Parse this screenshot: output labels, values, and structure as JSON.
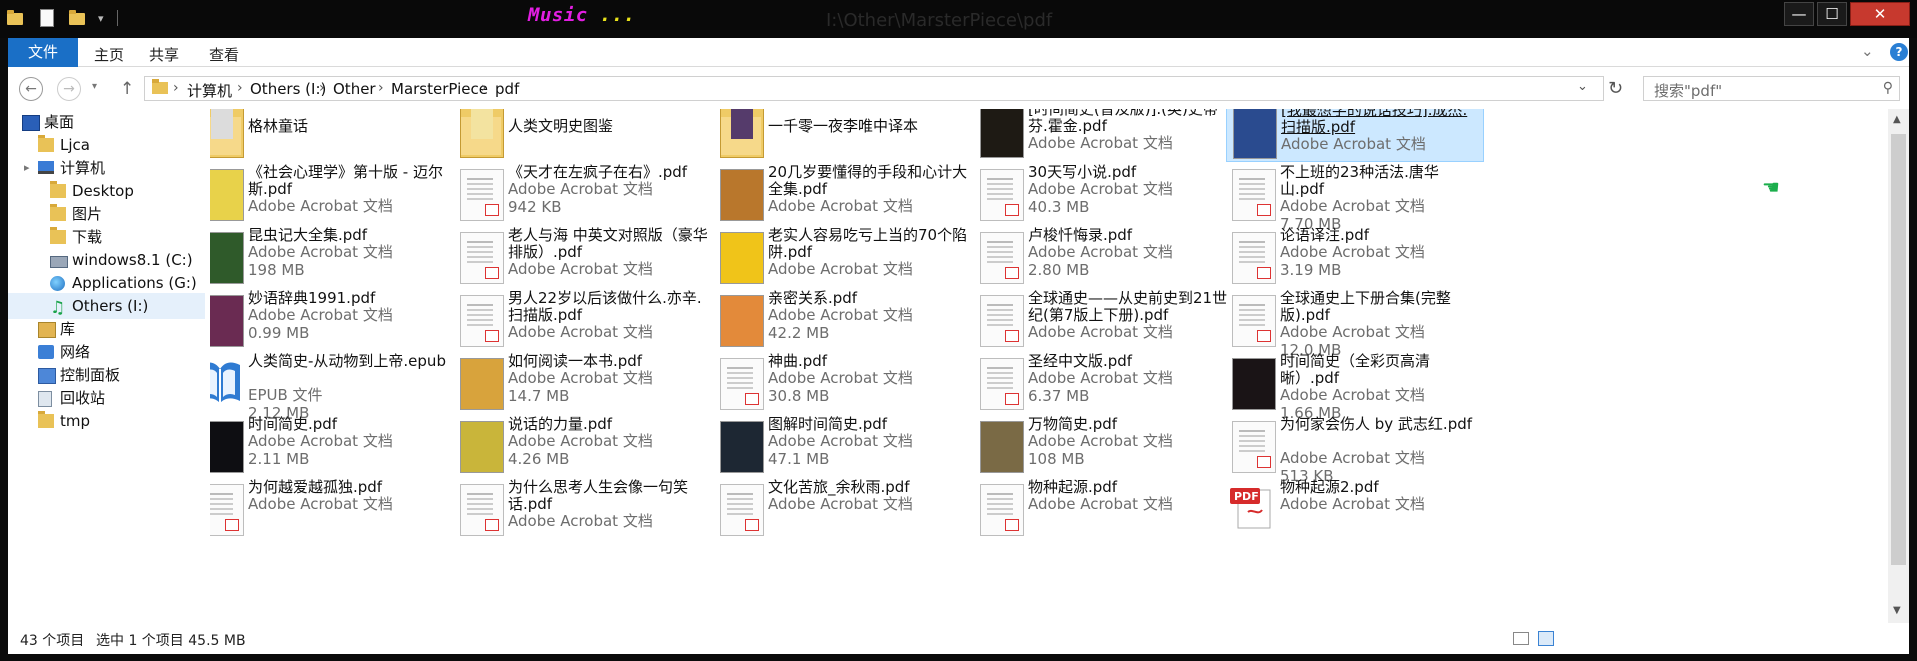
{
  "titlebar": {
    "app_title": "Music",
    "app_dots": " ...",
    "path_title": "I:\\Other\\MarsterPiece\\pdf",
    "quick_access_arrow": "▾",
    "minimize": "—",
    "maximize": "☐",
    "close": "✕"
  },
  "ribbon": {
    "file": "文件",
    "tabs": [
      "主页",
      "共享",
      "查看"
    ]
  },
  "address": {
    "crumbs": [
      "计算机",
      "Others (I:)",
      "Other",
      "MarsterPiece",
      "pdf"
    ],
    "search_placeholder": "搜索\"pdf\""
  },
  "nav": [
    {
      "label": "桌面",
      "icon": "desktop-icon"
    },
    {
      "label": "Ljca",
      "icon": "folder-icon"
    },
    {
      "label": "计算机",
      "icon": "computer-icon"
    },
    {
      "label": "Desktop",
      "icon": "folder-icon"
    },
    {
      "label": "图片",
      "icon": "folder-icon"
    },
    {
      "label": "下载",
      "icon": "folder-icon"
    },
    {
      "label": "windows8.1 (C:)",
      "icon": "drive-icon"
    },
    {
      "label": "Applications (G:)",
      "icon": "globe-drive-icon"
    },
    {
      "label": "Others (I:)",
      "icon": "music-drive-icon",
      "selected": true
    },
    {
      "label": "库",
      "icon": "library-icon"
    },
    {
      "label": "网络",
      "icon": "network-icon"
    },
    {
      "label": "控制面板",
      "icon": "control-panel-icon"
    },
    {
      "label": "回收站",
      "icon": "recycle-bin-icon"
    },
    {
      "label": "tmp",
      "icon": "folder-icon"
    }
  ],
  "files": [
    {
      "name": "格林童话",
      "type": "",
      "size": "",
      "thumb": "folder",
      "cover": "#dcdcdc"
    },
    {
      "name": "人类文明史图鉴",
      "type": "",
      "size": "",
      "thumb": "folder",
      "cover": "#f3e3a0"
    },
    {
      "name": "一千零一夜李唯中译本",
      "type": "",
      "size": "",
      "thumb": "folder",
      "cover": "#553b6b"
    },
    {
      "name": "[时间简史(普及版)].(英)史蒂芬.霍金.pdf",
      "type": "Adobe Acrobat 文档",
      "size": "",
      "thumb": "cover",
      "cover": "#1e1a14"
    },
    {
      "name": "[我最想学的说话技巧].成杰.扫描版.pdf",
      "type": "Adobe Acrobat 文档",
      "size": "",
      "thumb": "cover",
      "cover": "#2a4b8f",
      "selected": true
    },
    {
      "name": "《社会心理学》第十版 - 迈尔斯.pdf",
      "type": "Adobe Acrobat 文档",
      "size": "",
      "thumb": "cover",
      "cover": "#e8d24a"
    },
    {
      "name": "《天才在左疯子在右》.pdf",
      "type": "Adobe Acrobat 文档",
      "size": "942 KB",
      "thumb": "page",
      "cover": "#ffffff"
    },
    {
      "name": "20几岁要懂得的手段和心计大全集.pdf",
      "type": "Adobe Acrobat 文档",
      "size": "",
      "thumb": "cover",
      "cover": "#b9772c"
    },
    {
      "name": "30天写小说.pdf",
      "type": "Adobe Acrobat 文档",
      "size": "40.3 MB",
      "thumb": "page",
      "cover": "#ffffff"
    },
    {
      "name": "不上班的23种活法.唐华山.pdf",
      "type": "Adobe Acrobat 文档",
      "size": "7.70 MB",
      "thumb": "page",
      "cover": "#ffffff"
    },
    {
      "name": "昆虫记大全集.pdf",
      "type": "Adobe Acrobat 文档",
      "size": "198 MB",
      "thumb": "cover",
      "cover": "#2f5a2a"
    },
    {
      "name": "老人与海 中英文对照版（豪华排版）.pdf",
      "type": "Adobe Acrobat 文档",
      "size": "",
      "thumb": "page",
      "cover": "#ffffff"
    },
    {
      "name": "老实人容易吃亏上当的70个陷阱.pdf",
      "type": "Adobe Acrobat 文档",
      "size": "",
      "thumb": "cover",
      "cover": "#f0c419"
    },
    {
      "name": "卢梭忏悔录.pdf",
      "type": "Adobe Acrobat 文档",
      "size": "2.80 MB",
      "thumb": "page",
      "cover": "#ffffff"
    },
    {
      "name": "论语译注.pdf",
      "type": "Adobe Acrobat 文档",
      "size": "3.19 MB",
      "thumb": "page",
      "cover": "#ffffff"
    },
    {
      "name": "妙语辞典1991.pdf",
      "type": "Adobe Acrobat 文档",
      "size": "0.99 MB",
      "thumb": "cover",
      "cover": "#6a2b52"
    },
    {
      "name": "男人22岁以后该做什么.亦辛.扫描版.pdf",
      "type": "Adobe Acrobat 文档",
      "size": "",
      "thumb": "page",
      "cover": "#ffffff"
    },
    {
      "name": "亲密关系.pdf",
      "type": "Adobe Acrobat 文档",
      "size": "42.2 MB",
      "thumb": "cover",
      "cover": "#e38a3a"
    },
    {
      "name": "全球通史——从史前史到21世纪(第7版上下册).pdf",
      "type": "Adobe Acrobat 文档",
      "size": "",
      "thumb": "page",
      "cover": "#ffffff"
    },
    {
      "name": "全球通史上下册合集(完整版).pdf",
      "type": "Adobe Acrobat 文档",
      "size": "12.0 MB",
      "thumb": "page",
      "cover": "#ffffff"
    },
    {
      "name": "人类简史-从动物到上帝.epub",
      "type": "EPUB 文件",
      "size": "2.12 MB",
      "thumb": "epub",
      "cover": "#2f7bd2"
    },
    {
      "name": "如何阅读一本书.pdf",
      "type": "Adobe Acrobat 文档",
      "size": "14.7 MB",
      "thumb": "cover",
      "cover": "#d8a33c"
    },
    {
      "name": "神曲.pdf",
      "type": "Adobe Acrobat 文档",
      "size": "30.8 MB",
      "thumb": "page",
      "cover": "#ffffff"
    },
    {
      "name": "圣经中文版.pdf",
      "type": "Adobe Acrobat 文档",
      "size": "6.37 MB",
      "thumb": "page",
      "cover": "#ffffff"
    },
    {
      "name": "时间简史（全彩页高清晰）.pdf",
      "type": "Adobe Acrobat 文档",
      "size": "1.66 MB",
      "thumb": "cover",
      "cover": "#1a1416"
    },
    {
      "name": "时间简史.pdf",
      "type": "Adobe Acrobat 文档",
      "size": "2.11 MB",
      "thumb": "cover",
      "cover": "#0e0e12"
    },
    {
      "name": "说话的力量.pdf",
      "type": "Adobe Acrobat 文档",
      "size": "4.26 MB",
      "thumb": "cover",
      "cover": "#c9b53a"
    },
    {
      "name": "图解时间简史.pdf",
      "type": "Adobe Acrobat 文档",
      "size": "47.1 MB",
      "thumb": "cover",
      "cover": "#1d2733"
    },
    {
      "name": "万物简史.pdf",
      "type": "Adobe Acrobat 文档",
      "size": "108 MB",
      "thumb": "cover",
      "cover": "#7a6a45"
    },
    {
      "name": "为何家会伤人 by 武志红.pdf",
      "type": "Adobe Acrobat 文档",
      "size": "513 KB",
      "thumb": "page",
      "cover": "#ffffff"
    },
    {
      "name": "为何越爱越孤独.pdf",
      "type": "Adobe Acrobat 文档",
      "size": "",
      "thumb": "page",
      "cover": "#ffffff"
    },
    {
      "name": "为什么思考人生会像一句笑话.pdf",
      "type": "Adobe Acrobat 文档",
      "size": "",
      "thumb": "page",
      "cover": "#ffffff"
    },
    {
      "name": "文化苦旅_余秋雨.pdf",
      "type": "Adobe Acrobat 文档",
      "size": "",
      "thumb": "page",
      "cover": "#ffffff"
    },
    {
      "name": "物种起源.pdf",
      "type": "Adobe Acrobat 文档",
      "size": "",
      "thumb": "page",
      "cover": "#ffffff"
    },
    {
      "name": "物种起源2.pdf",
      "type": "Adobe Acrobat 文档",
      "size": "",
      "thumb": "pdficon",
      "cover": "#d62b2b"
    }
  ],
  "status": {
    "count": "43 个项目",
    "selection": "选中 1 个项目  45.5 MB"
  },
  "colors": {
    "accent": "#1a6fc6",
    "selection": "#cce8ff",
    "titlebar": "#090909"
  }
}
